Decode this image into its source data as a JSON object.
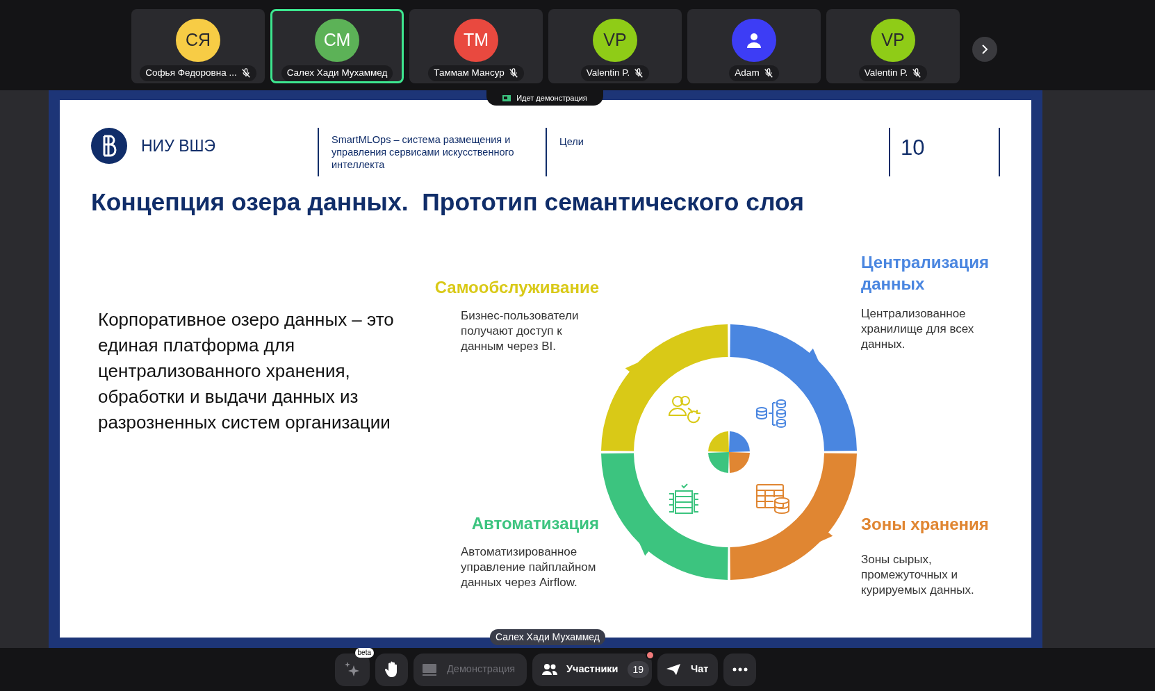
{
  "participants": [
    {
      "initials": "СЯ",
      "name": "Софья Федоровна ...",
      "color": "#f7cc45",
      "muted": true,
      "selected": false,
      "kind": "initials"
    },
    {
      "initials": "СМ",
      "name": "Салех Хади Мухаммед",
      "color": "#5cb257",
      "muted": false,
      "selected": true,
      "kind": "initials"
    },
    {
      "initials": "ТМ",
      "name": "Таммам Мансур",
      "color": "#e9493f",
      "muted": true,
      "selected": false,
      "kind": "initials"
    },
    {
      "initials": "VP",
      "name": "Valentin P.",
      "color": "#8fcc17",
      "muted": true,
      "selected": false,
      "kind": "initials"
    },
    {
      "name": "Adam",
      "color": "#3d3df5",
      "muted": true,
      "selected": false,
      "kind": "icon"
    },
    {
      "initials": "VP",
      "name": "Valentin P.",
      "color": "#8fcc17",
      "muted": true,
      "selected": false,
      "kind": "initials"
    }
  ],
  "sharing_banner": "Идет демонстрация",
  "slide": {
    "org": "НИУ ВШЭ",
    "project": "SmartMLOps – система размещения и управления сервисами искусственного интеллекта",
    "section": "Цели",
    "page_number": "10",
    "title": "Концепция озера данных.  Прототип семантического слоя",
    "paragraph": "Корпоративное озеро данных – это единая платформа для централизованного хранения, обработки и выдачи данных из разрозненных систем организации",
    "segments": [
      {
        "title": "Самообслуживание",
        "description": "Бизнес-пользователи получают доступ к данным через BI.",
        "color": "#d9c917"
      },
      {
        "title": "Автоматизация",
        "description": "Автоматизированное управление пайплайном данных через Airflow.",
        "color": "#3cc47f"
      },
      {
        "title": "Централизация данных",
        "description": "Централизованное хранилище для всех данных.",
        "color": "#4a86e0"
      },
      {
        "title": "Зоны хранения",
        "description": "Зоны сырых, промежуточных и курируемых данных.",
        "color": "#e08632"
      }
    ]
  },
  "presenter_label": "Салех Хади Мухаммед",
  "toolbar": {
    "ai_badge": "beta",
    "demo": {
      "label": "Демонстрация",
      "disabled": true
    },
    "participants": {
      "label": "Участники",
      "count": "19",
      "notification": true
    },
    "chat": "Чат"
  }
}
